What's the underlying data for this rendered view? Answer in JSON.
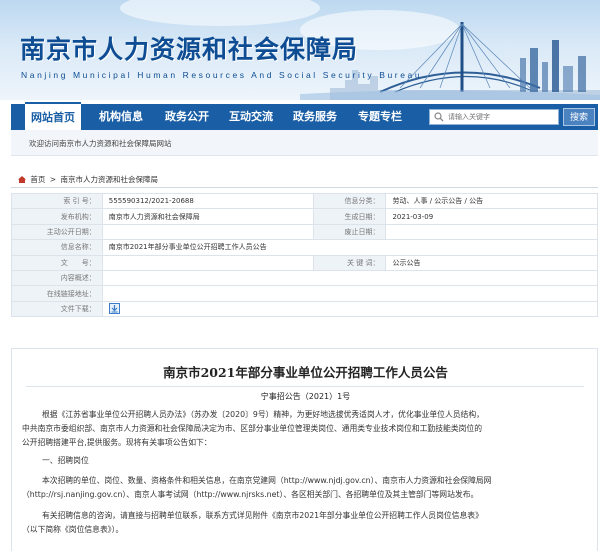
{
  "banner": {
    "title": "南京市人力资源和社会保障局",
    "subtitle": "Nanjing Municipal Human Resources And Social Security Bureau"
  },
  "nav": {
    "items": [
      "网站首页",
      "机构信息",
      "政务公开",
      "互动交流",
      "政务服务",
      "专题专栏"
    ],
    "search_placeholder": "请输入关键字",
    "search_button": "搜索"
  },
  "welcome": "欢迎访问南京市人力资源和社会保障局网站",
  "breadcrumb": {
    "home": "首页",
    "current": "南京市人力资源和社会保障局"
  },
  "info": {
    "index_no_label": "索 引 号：",
    "index_no": "555590312/2021-20688",
    "category_label": "信息分类：",
    "category": "劳动、人事 / 公示公告 / 公告",
    "publisher_label": "发布机构：",
    "publisher": "南京市人力资源和社会保障局",
    "date_label": "生成日期：",
    "date": "2021-03-09",
    "subject_label": "主动公开日期：",
    "subject": "",
    "abolish_label": "废止日期：",
    "abolish": "",
    "name_label": "信息名称：",
    "name": "南京市2021年部分事业单位公开招聘工作人员公告",
    "docno_label": "文　　号：",
    "docno": "",
    "keyword_label": "关 键 词：",
    "keyword": "公示公告",
    "summary_label": "内容概述：",
    "summary": "",
    "online_label": "在线链接地址：",
    "online": "",
    "download_label": "文件下载："
  },
  "article": {
    "title": "南京市2021年部分事业单位公开招聘工作人员公告",
    "doc_no": "宁事招公告（2021）1号",
    "paragraphs": [
      "根据《江苏省事业单位公开招聘人员办法》（苏办发〔2020〕9号）精神，为更好地选拔优秀适岗人才，优化事业单位人员结构，",
      "中共南京市委组织部、南京市人力资源和社会保障局决定为市、区部分事业单位管理类岗位、通用类专业技术岗位和工勤技能类岗位的",
      "公开招聘搭建平台,提供服务。现将有关事项公告如下：",
      "一、招聘岗位",
      "本次招聘的单位、岗位、数量、资格条件和相关信息，在南京党建网（http://www.njdj.gov.cn）、南京市人力资源和社会保障局网",
      "（http://rsj.nanjing.gov.cn）、南京人事考试网（http://www.njrsks.net）、各区相关部门、各招聘单位及其主管部门等网站发布。",
      "有关招聘信息的咨询，请直接与招聘单位联系，联系方式详见附件《南京市2021年部分事业单位公开招聘工作人员岗位信息表》",
      "（以下简称《岗位信息表》）。"
    ]
  }
}
